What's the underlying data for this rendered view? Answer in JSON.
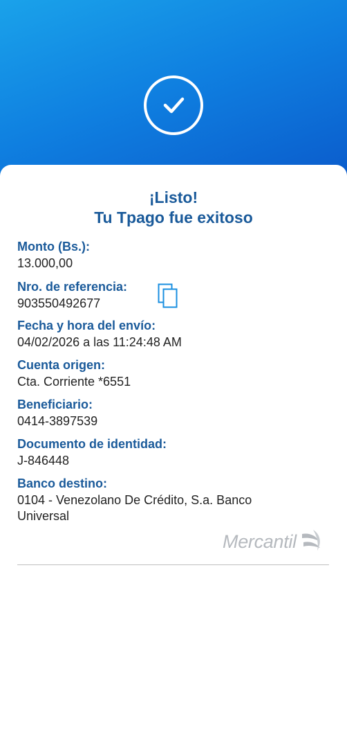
{
  "header": {
    "icon": "check-circle-icon",
    "gradient_start": "#1aa2ea",
    "gradient_end": "#0a55c8"
  },
  "receipt": {
    "title_line1": "¡Listo!",
    "title_line2": "Tu Tpago fue exitoso",
    "label_color": "#1a5a9a",
    "fields": [
      {
        "label": "Monto (Bs.):",
        "value": "13.000,00"
      },
      {
        "label": "Nro. de referencia:",
        "value": "903550492677"
      },
      {
        "label": "Fecha y hora del envío:",
        "value": "04/02/2026 a las 11:24:48 AM"
      },
      {
        "label": "Cuenta origen:",
        "value": "Cta. Corriente *6551"
      },
      {
        "label": "Beneficiario:",
        "value": "0414-3897539"
      },
      {
        "label": "Documento de identidad:",
        "value": "J-846448"
      },
      {
        "label": "Banco destino:",
        "value": "0104 - Venezolano De Crédito, S.a. Banco Universal"
      }
    ],
    "copy_icon": "copy-icon"
  },
  "brand": {
    "name": "Mercantil",
    "logo_icon": "mercantil-logo-icon"
  }
}
